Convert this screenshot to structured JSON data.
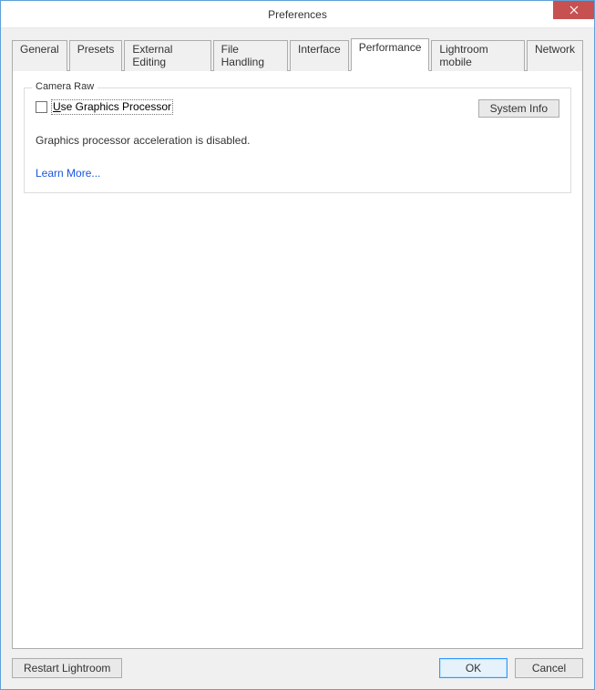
{
  "window": {
    "title": "Preferences"
  },
  "tabs": {
    "general": "General",
    "presets": "Presets",
    "external_editing": "External Editing",
    "file_handling": "File Handling",
    "interface": "Interface",
    "performance": "Performance",
    "lightroom_mobile": "Lightroom mobile",
    "network": "Network"
  },
  "panel": {
    "group_title": "Camera Raw",
    "checkbox_prefix": "U",
    "checkbox_rest": "se Graphics Processor",
    "system_info_btn": "System Info",
    "status": "Graphics processor acceleration is disabled.",
    "learn_more": "Learn More..."
  },
  "footer": {
    "restart": "Restart Lightroom",
    "ok": "OK",
    "cancel": "Cancel"
  }
}
